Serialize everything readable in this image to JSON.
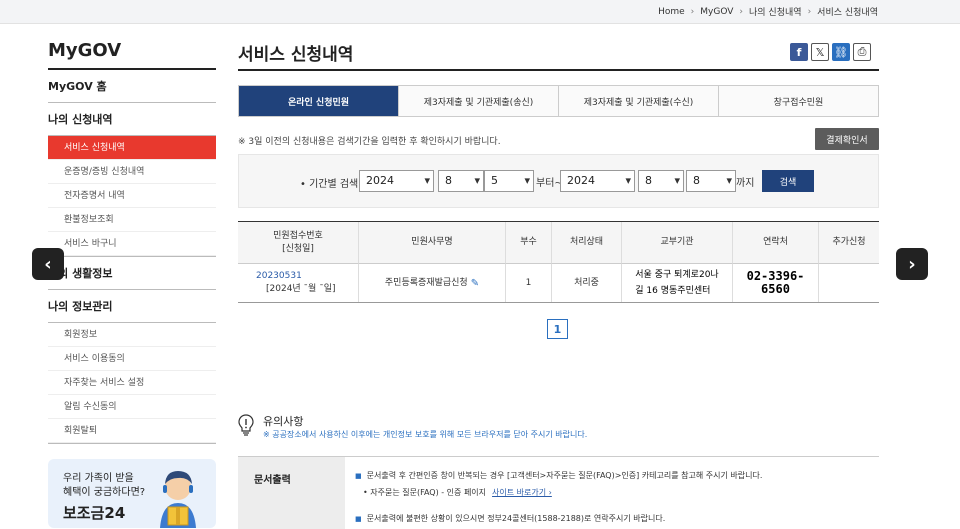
{
  "breadcrumb": [
    "Home",
    "MyGOV",
    "나의 신청내역",
    "서비스 신청내역"
  ],
  "sidebar": {
    "title": "MyGOV",
    "sections": [
      {
        "label": "MyGOV 홈",
        "items": []
      },
      {
        "label": "나의 신청내역",
        "items": [
          "서비스 신청내역",
          "운증명/증빙 신청내역",
          "전자증명서 내역",
          "환불정보조회",
          "서비스 바구니"
        ]
      },
      {
        "label": "나의 생활정보",
        "items": []
      },
      {
        "label": "나의 정보관리",
        "items": [
          "회원정보",
          "서비스 이용동의",
          "자주찾는 서비스 설정",
          "알림 수신동의",
          "회원탈퇴"
        ]
      }
    ],
    "promo": {
      "line1": "우리 가족이 받을",
      "line2": "혜택이 궁금하다면?",
      "title": "보조금24"
    }
  },
  "page_title": "서비스 신청내역",
  "share_icons": [
    "facebook-icon",
    "x-icon",
    "link-icon",
    "print-icon"
  ],
  "tabs": [
    "온라인 신청민원",
    "제3자제출 및 기관제출(송신)",
    "제3자제출 및 기관제출(수신)",
    "창구접수민원"
  ],
  "notice": "※ 3일 이전의 신청내용은 검색기간을 입력한 후 확인하시기 바랍니다.",
  "cert_button": "결제확인서",
  "search": {
    "label": "• 기간별 검색",
    "from": {
      "year": "2024",
      "month": "8",
      "day": "5"
    },
    "from_suffix": "부터~",
    "to": {
      "year": "2024",
      "month": "8",
      "day": "8"
    },
    "to_suffix": "까지",
    "button": "검색"
  },
  "table": {
    "headers": [
      "민원접수번호\n[신청일]",
      "민원사무명",
      "부수",
      "처리상태",
      "교부기관",
      "연락처",
      "추가신청"
    ],
    "rows": [
      {
        "receipt_no": "20230531",
        "date": "[2024년 ¯월 ¯일]",
        "name": "주민등록증재발급신청",
        "copies": "1",
        "status": "처리중",
        "agency_line1": "서울 중구 퇴계로20나",
        "agency_line2": "길 16 명동주민센터",
        "phone": "02-3396-6560",
        "extra": ""
      }
    ]
  },
  "pagination": {
    "current": "1"
  },
  "caution": {
    "title": "유의사항",
    "text": "※ 공공장소에서 사용하신 이후에는 개인정보 보호를 위해 모든 브라우저를 닫아 주시기 바랍니다."
  },
  "doc_output": {
    "header": "문서출력",
    "line1": "문서출력 후 간편인증 창이 반복되는 경우 [고객센터>자주묻는 질문(FAQ)>인증] 카테고리를 참고해 주시기 바랍니다.",
    "line2": "• 자주묻는 질문(FAQ) - 인증 페이지",
    "line2_link": "사이트 바로가기 ›",
    "line3": "문서출력에 불편한 상황이 있으시면 정부24콜센터(1588-2188)로 연락주시기 바랍니다."
  },
  "colors": {
    "accent_red": "#e8392e",
    "navy": "#20427b",
    "link_blue": "#2a5ba8"
  }
}
